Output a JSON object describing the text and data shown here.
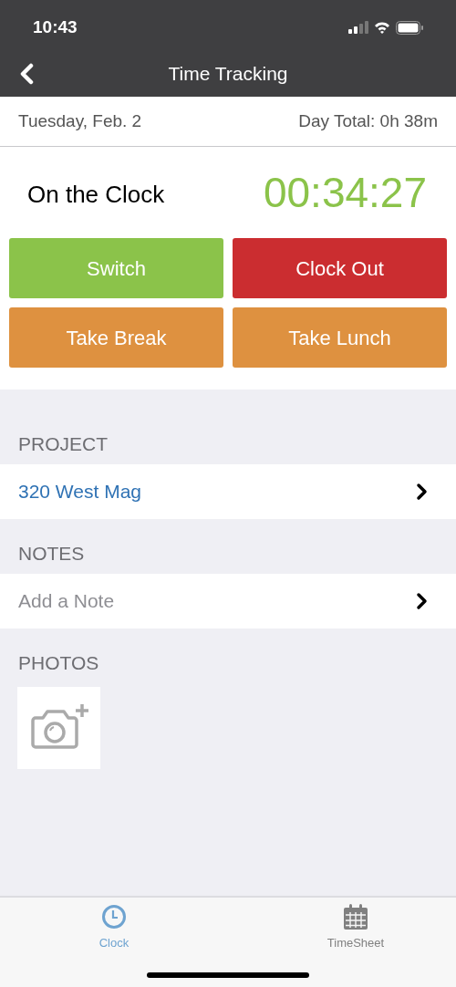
{
  "status_bar": {
    "time": "10:43"
  },
  "nav": {
    "title": "Time Tracking"
  },
  "summary": {
    "date": "Tuesday, Feb. 2",
    "day_total": "Day Total: 0h 38m"
  },
  "clock": {
    "status": "On the Clock",
    "elapsed": "00:34:27"
  },
  "actions": [
    {
      "label": "Switch",
      "kind": "switch"
    },
    {
      "label": "Clock Out",
      "kind": "stop"
    },
    {
      "label": "Take Break",
      "kind": "break"
    },
    {
      "label": "Take Lunch",
      "kind": "break"
    }
  ],
  "sections": [
    {
      "header": "PROJECT",
      "row": {
        "text": "320 West Mag",
        "kind": "value"
      }
    },
    {
      "header": "NOTES",
      "row": {
        "text": "Add a Note",
        "kind": "placeholder"
      }
    },
    {
      "header": "PHOTOS",
      "kind": "photos"
    }
  ],
  "tabs": [
    {
      "label": "Clock",
      "kind": "clock",
      "selected": true
    },
    {
      "label": "TimeSheet",
      "kind": "calendar",
      "selected": false
    }
  ]
}
